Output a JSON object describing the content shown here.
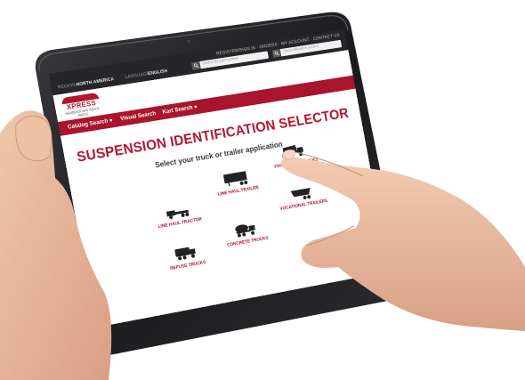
{
  "site": {
    "account_links": "REGISTER/SIGN IN · ORDERS · MY ACCOUNT · CONTACT US",
    "region_label": "REGION:",
    "region_value": "NORTH AMERICA",
    "language_label": "LANGUAGE:",
    "language_value": "ENGLISH",
    "search_1_placeholder": "Search by part number",
    "search_2_placeholder": "Cross reference search",
    "logo_word": "XPRESS",
    "logo_sub": "HENDRICKSON TRUCK PARTS"
  },
  "nav": {
    "item_1": "Catalog Search",
    "item_2": "Visual Search",
    "item_3": "Kart Search"
  },
  "main": {
    "title": "SUSPENSION IDENTIFICATION SELECTOR",
    "subtitle": "Select your truck or trailer application"
  },
  "applications": [
    {
      "label": "LINE HAUL TRACTOR",
      "icon": "tractor-icon"
    },
    {
      "label": "LINE HAUL TRAILER",
      "icon": "trailer-icon"
    },
    {
      "label": "VOCATIONAL TRUCKS",
      "icon": "dump-truck-icon"
    },
    {
      "label": "REFUSE TRUCKS",
      "icon": "refuse-truck-icon"
    },
    {
      "label": "CONCRETE TRUCKS",
      "icon": "mixer-truck-icon"
    },
    {
      "label": "VOCATIONAL TRAILERS",
      "icon": "vocational-trailer-icon"
    }
  ],
  "colors": {
    "brand_red": "#b3162e",
    "nav_red": "#a9152c",
    "top_bar": "#26262a",
    "bezel": "#1c1c1f",
    "skin": "#e8b89c"
  }
}
